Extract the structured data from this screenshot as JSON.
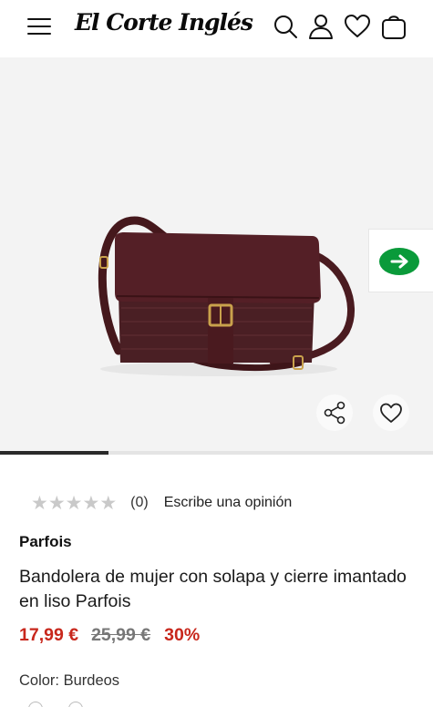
{
  "header": {
    "logo_text": "El Corte Inglés",
    "icons": [
      "menu-icon",
      "search-icon",
      "user-icon",
      "heart-icon",
      "bag-icon"
    ]
  },
  "gallery": {
    "image_subject": "Bandolera burdeos con solapa y hebilla",
    "progress_fraction": 0.25
  },
  "rating": {
    "stars_total": 5,
    "stars_filled": 0,
    "count": "(0)",
    "write_review": "Escribe una opinión"
  },
  "product": {
    "brand": "Parfois",
    "title": "Bandolera de mujer con solapa y cierre imantado en liso Parfois",
    "price_current": "17,99 €",
    "price_old": "25,99 €",
    "discount": "30%",
    "color_label": "Color: Burdeos"
  },
  "colors": {
    "accent_red": "#c8271c",
    "bag_main": "#4e1d22",
    "chat_green": "#0a9a3a"
  }
}
